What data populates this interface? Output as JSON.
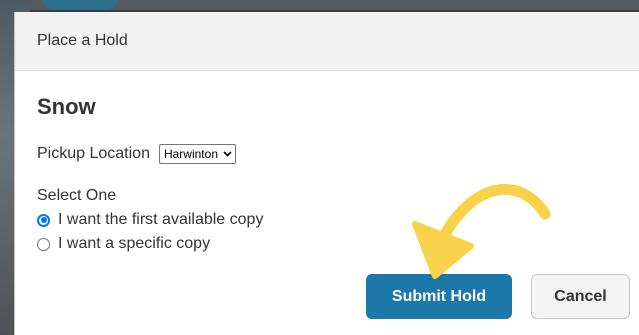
{
  "modal": {
    "title": "Place a Hold",
    "book_title": "Snow",
    "pickup": {
      "label": "Pickup Location",
      "selected": "Harwinton"
    },
    "select_one_label": "Select One",
    "options": [
      {
        "label": "I want the first available copy",
        "checked": true
      },
      {
        "label": "I want a specific copy",
        "checked": false
      }
    ],
    "buttons": {
      "submit_label": "Submit Hold",
      "cancel_label": "Cancel"
    }
  },
  "colors": {
    "primary_button": "#1b78a8",
    "radio_accent": "#0075ff",
    "annotation_arrow": "#f7d24a"
  },
  "icons": {
    "select_chevron": "chevron-down-icon",
    "annotation": "curved-arrow-icon"
  }
}
